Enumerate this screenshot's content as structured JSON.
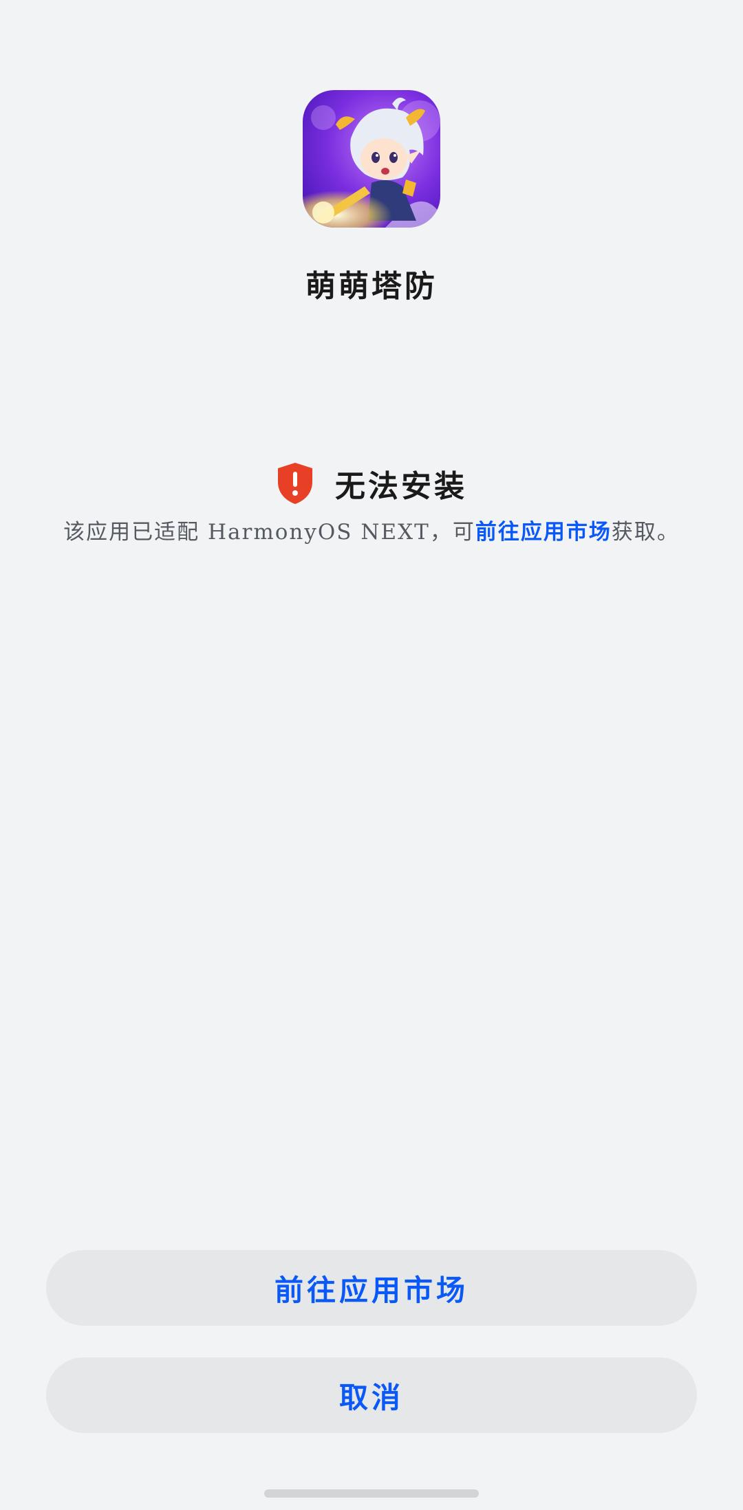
{
  "app": {
    "icon_name": "app-icon",
    "name": "萌萌塔防"
  },
  "status": {
    "icon_name": "shield-alert-icon",
    "title": "无法安装",
    "description_prefix": "该应用已适配 HarmonyOS NEXT，可",
    "description_link": "前往应用市场",
    "description_suffix": "获取。"
  },
  "buttons": {
    "go_to_market": "前往应用市场",
    "cancel": "取消"
  },
  "colors": {
    "background": "#f1f3f5",
    "accent": "#0a59f7",
    "alert": "#e84026",
    "button_bg": "#e6e7e9"
  }
}
